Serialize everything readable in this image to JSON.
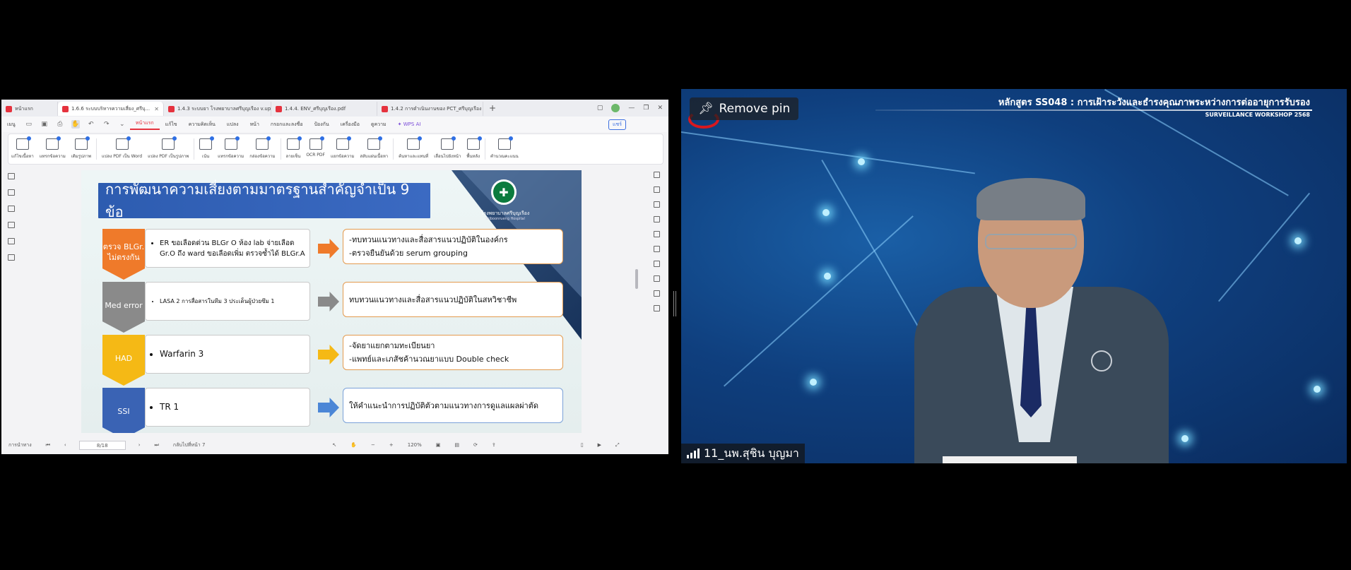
{
  "share": {
    "tabs": [
      {
        "label": "หน้าแรก",
        "active": false
      },
      {
        "label": "1.6.6 ระบบบริหารความเสี่ยง_ศรีบุ...",
        "active": true
      },
      {
        "label": "1.4.3 ระบบยา โรงพยาบาลศรีบุญเรือง v.upd...",
        "active": false
      },
      {
        "label": "1.4.4. ENV_ศรีบุญเรือง.pdf",
        "active": false
      },
      {
        "label": "1.4.2 การดำเนินงานของ PCT_ศรีบุญเรือง ...",
        "active": false
      }
    ],
    "menu": [
      "เมนู",
      "หน้าแรก",
      "แก้ไข",
      "ความคิดเห็น",
      "แปลง",
      "หน้า",
      "กรอกและลงชื่อ",
      "ป้องกัน",
      "เครื่องมือ",
      "ดูความ",
      "WPS AI"
    ],
    "active_menu": "หน้าแรก",
    "share_label": "แชร์",
    "ribbon": [
      "แก้ไขเนื้อหา",
      "แทรกข้อความ",
      "เติมรูปภาพ",
      "แปลง PDF เป็น Word",
      "แปลง PDF เป็นรูปภาพ",
      "เน้น",
      "แทรกข้อความ",
      "กล่องข้อความ",
      "ลายเซ็น",
      "OCR PDF",
      "แยกข้อความ",
      "สลับแผ่นเนื้อหา",
      "ค้นหาและแทนที่",
      "เลื่อนไปยังหน้า",
      "พื้นหลัง",
      "คำนวณคะแนน"
    ],
    "slide": {
      "title": "การพัฒนาความเสี่ยงตามมาตรฐานสำคัญจำเป็น 9 ข้อ",
      "hospital_th": "โรงพยาบาลศรีบุญเรือง",
      "hospital_en": "Sriboonrueng Hospital",
      "rows": [
        {
          "tag": "ตรวจ BLGr. ไม่ตรงกัน",
          "color": "#ef7a2a",
          "left": "ER ขอเลือดด่วน BLGr O ห้อง lab จ่ายเลือด Gr.O ถึง ward ขอเลือดเพิ่ม ตรวจซ้ำได้ BLGr.A",
          "right": [
            "-ทบทวนแนวทางและสื่อสารแนวปฏิบัติในองค์กร",
            "-ตรวจยืนยันด้วย serum grouping"
          ],
          "arrow": "#ef7a2a"
        },
        {
          "tag": "Med error",
          "color": "#8a8a8a",
          "left": "LASA 2  การสื่อสารในทีม 3  ประเด็นผู้ป่วยซึม 1",
          "right": [
            "ทบทวนแนวทางและสื่อสารแนวปฏิบัติในสหวิชาชีพ"
          ],
          "arrow": "#8a8a8a"
        },
        {
          "tag": "HAD",
          "color": "#f5b915",
          "left": "Warfarin 3",
          "right": [
            "-จัดยาแยกตามทะเบียนยา",
            "-แพทย์และเภสัชค้านวณยาแบบ Double check"
          ],
          "arrow": "#f5b915"
        },
        {
          "tag": "SSI",
          "color": "#3a63b4",
          "left": "TR 1",
          "right": [
            "ให้คำแนะนำการปฏิบัติตัวตามแนวทางการดูแลแผลผ่าตัด"
          ],
          "arrow": "#4b86d6"
        }
      ]
    },
    "status": {
      "thumbnails_label": "การนำทาง",
      "page": "8/18",
      "return_label": "กลับไปที่หน้า 7",
      "zoom": "120%"
    }
  },
  "video": {
    "pin_label": "Remove pin",
    "course_title": "หลักสูตร SS048 : การเฝ้าระวังและธำรงคุณภาพระหว่างการต่ออายุการรับรอง",
    "workshop": "SURVEILLANCE WORKSHOP 2568",
    "participant": "11_นพ.สุชิน บุญมา"
  }
}
